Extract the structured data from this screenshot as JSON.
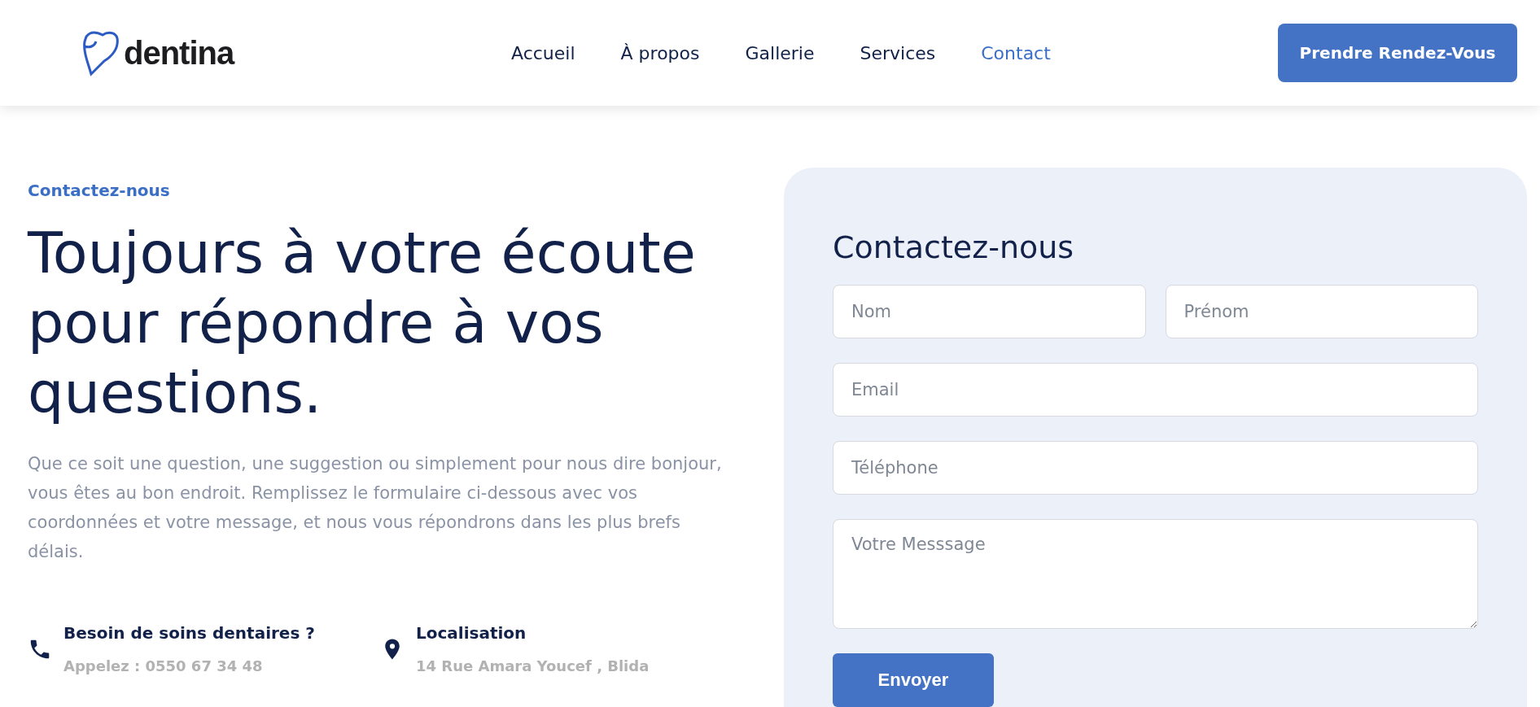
{
  "header": {
    "logo": "dentina",
    "nav": [
      {
        "label": "Accueil",
        "selected": false
      },
      {
        "label": "À propos",
        "selected": false
      },
      {
        "label": "Gallerie",
        "selected": false
      },
      {
        "label": "Services",
        "selected": false
      },
      {
        "label": "Contact",
        "selected": true
      }
    ],
    "cta": "Prendre Rendez-Vous"
  },
  "intro": {
    "eyebrow": "Contactez-nous",
    "heading": "Toujours à votre écoute pour répondre à vos questions.",
    "text": "Que ce soit une question, une suggestion ou simplement pour nous dire bonjour, vous êtes au bon endroit. Remplissez le formulaire ci-dessous avec vos coordonnées et votre message, et nous vous répondrons dans les plus brefs délais.",
    "info": [
      {
        "kind": "phone",
        "title": "Besoin de soins dentaires ?",
        "detail": "Appelez : 0550 67 34 48"
      },
      {
        "kind": "location",
        "title": "Localisation",
        "detail": "14 Rue Amara Youcef , Blida"
      }
    ]
  },
  "form": {
    "title": "Contactez-nous",
    "fields": [
      {
        "kind": "half",
        "placeholder": "Nom"
      },
      {
        "kind": "half",
        "placeholder": "Prénom"
      },
      {
        "kind": "full",
        "placeholder": "Email"
      },
      {
        "kind": "full",
        "placeholder": "Téléphone"
      },
      {
        "kind": "textarea",
        "placeholder": "Votre Messsage"
      }
    ],
    "submit": "Envoyer"
  }
}
